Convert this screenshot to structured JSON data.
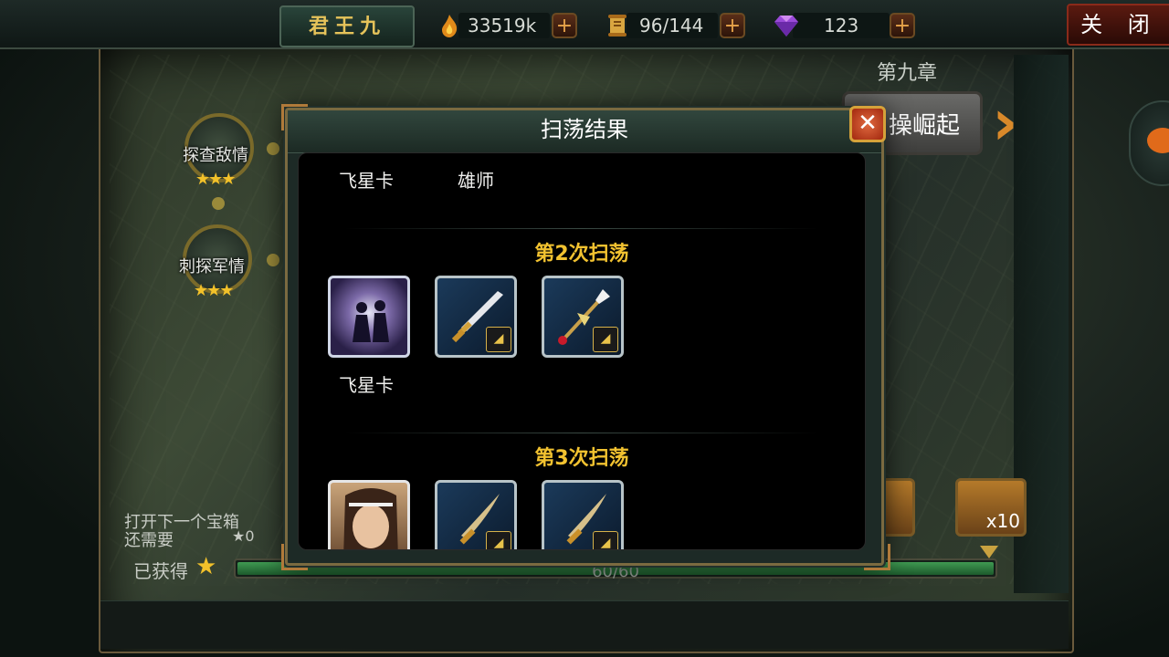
{
  "topbar": {
    "player_name": "君王九",
    "resources": [
      {
        "icon": "flame-icon",
        "value": "33519k",
        "plus": "+"
      },
      {
        "icon": "scroll-icon",
        "value": "96/144",
        "plus": "+"
      },
      {
        "icon": "gem-icon",
        "value": "123",
        "plus": "+"
      }
    ],
    "close_label": "关 闭"
  },
  "map": {
    "chapter_label": "第九章",
    "chapter_button": "操崛起",
    "stages": [
      {
        "label": "探查敌情",
        "stars": "★★★"
      },
      {
        "label": "刺探军情",
        "stars": "★★★"
      }
    ],
    "chest_info": {
      "open_next_line1": "打开下一个宝箱",
      "open_next_line2": "还需要",
      "need_stars": "★0",
      "obtained_label": "已获得",
      "obtained_star": "★"
    },
    "progress": {
      "text": "60/60",
      "fraction": 1.0
    },
    "chest_count": "x10"
  },
  "modal": {
    "title": "扫荡结果",
    "close_glyph": "✕",
    "first_row_names": [
      "飞星卡",
      "雄师"
    ],
    "sweeps": [
      {
        "title": "第2次扫荡",
        "items": [
          {
            "type": "card",
            "name": "飞星卡"
          },
          {
            "type": "weapon-sword"
          },
          {
            "type": "weapon-spear"
          }
        ]
      },
      {
        "title": "第3次扫荡",
        "items": [
          {
            "type": "portrait"
          },
          {
            "type": "weapon-blade"
          },
          {
            "type": "weapon-blade"
          }
        ]
      }
    ]
  }
}
